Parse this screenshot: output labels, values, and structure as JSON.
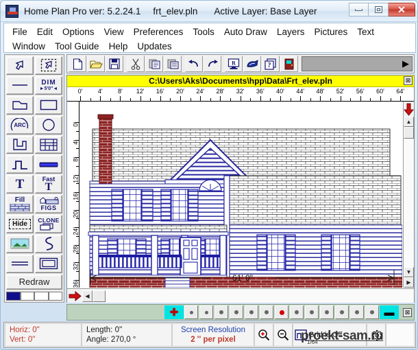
{
  "window": {
    "app_title": "Home Plan Pro ver: 5.2.24.1",
    "file_name": "frt_elev.pln",
    "active_layer": "Active Layer: Base Layer",
    "minimize_label": "Minimize",
    "maximize_label": "Maximize",
    "close_label": "✕",
    "app_icon": "home-plan-pro-icon"
  },
  "menu": {
    "row1": [
      "File",
      "Edit",
      "Options",
      "View",
      "Preferences",
      "Tools",
      "Auto Draw",
      "Layers",
      "Pictures",
      "Text"
    ],
    "row2": [
      "Window",
      "Tool Guide",
      "Help",
      "Updates"
    ]
  },
  "toolbar": {
    "buttons": [
      {
        "name": "new-file-icon",
        "label": "New"
      },
      {
        "name": "open-file-icon",
        "label": "Open"
      },
      {
        "name": "save-file-icon",
        "label": "Save"
      },
      {
        "name": "cut-icon",
        "label": "Cut"
      },
      {
        "name": "copy-icon",
        "label": "Copy"
      },
      {
        "name": "paste-icon",
        "label": "Paste"
      },
      {
        "name": "undo-icon",
        "label": "Undo"
      },
      {
        "name": "redo-icon",
        "label": "Redo"
      },
      {
        "name": "redraw-screen-icon",
        "label": "R"
      },
      {
        "name": "print-icon",
        "label": "Print"
      },
      {
        "name": "help-icon",
        "label": "Help"
      },
      {
        "name": "door-icon",
        "label": "Door"
      }
    ],
    "combo_value": "",
    "combo_arrow": "▶"
  },
  "tool_palette": {
    "rows": [
      [
        {
          "name": "select-arrow-tool",
          "label": ""
        },
        {
          "name": "marquee-select-tool",
          "label": ""
        }
      ],
      [
        {
          "name": "line-tool",
          "label": ""
        },
        {
          "name": "dimension-tool",
          "label": "DIM"
        }
      ],
      [
        {
          "name": "polygon-tool",
          "label": ""
        },
        {
          "name": "rectangle-tool",
          "label": ""
        }
      ],
      [
        {
          "name": "arc-tool",
          "label": "ARC"
        },
        {
          "name": "circle-tool",
          "label": ""
        }
      ],
      [
        {
          "name": "wall-tool",
          "label": ""
        },
        {
          "name": "window-tool",
          "label": ""
        }
      ],
      [
        {
          "name": "stairs-tool",
          "label": ""
        },
        {
          "name": "beam-tool",
          "label": ""
        }
      ],
      [
        {
          "name": "text-tool",
          "label": "T"
        },
        {
          "name": "fast-text-tool",
          "label": "Fast T"
        }
      ],
      [
        {
          "name": "fill-tool",
          "label": "Fill"
        },
        {
          "name": "figures-tool",
          "label": "FIGS"
        }
      ],
      [
        {
          "name": "hide-tool",
          "label": "Hide"
        },
        {
          "name": "clone-tool",
          "label": "CLONE"
        }
      ],
      [
        {
          "name": "picture-tool",
          "label": ""
        },
        {
          "name": "curve-tool",
          "label": ""
        }
      ],
      [
        {
          "name": "double-line-tool",
          "label": ""
        },
        {
          "name": "frame-tool",
          "label": ""
        }
      ]
    ],
    "redraw_label": "Redraw",
    "color_swatches": [
      "#10108c",
      "#ffffff",
      "#ffffff",
      "#ffffff"
    ]
  },
  "canvas": {
    "file_path": "C:\\Users\\Aks\\Documents\\hpp\\Data\\Frt_elev.pln",
    "close_label": "⊠",
    "h_ruler_labels": [
      "0'",
      "4'",
      "8'",
      "12'",
      "16'",
      "20'",
      "24'",
      "28'",
      "32'",
      "36'",
      "40'",
      "44'",
      "48'",
      "52'",
      "56'",
      "60'",
      "64'"
    ],
    "v_ruler_labels": [
      "0'",
      "4'",
      "8'",
      "12'",
      "16'",
      "20'",
      "24'",
      "28'",
      "32'",
      "36'"
    ],
    "dimension_label": "61' 0\"",
    "drawing_name": "front-elevation-house-drawing",
    "scroll_up": "▲",
    "scroll_down": "▼",
    "scroll_left": "◀",
    "scroll_right": "▶"
  },
  "line_weight_bar": {
    "increase_label": "✚",
    "decrease_label": "▬",
    "dot_sizes": [
      5,
      5,
      6,
      6,
      6,
      6,
      7,
      6,
      6,
      6,
      6,
      6,
      6
    ],
    "selected_index": 6,
    "close_label": "⊠"
  },
  "status": {
    "horiz_label": "Horiz:",
    "horiz_value": "0\"",
    "vert_label": "Vert:",
    "vert_value": "0\"",
    "length_label": "Length:",
    "length_value": "0''",
    "angle_label": "Angle:",
    "angle_value": "270,0 °",
    "resolution_title": "Screen Resolution",
    "resolution_value": "2 '' per pixel",
    "zoom_in": "zoom-in-icon",
    "zoom_out": "zoom-out-icon",
    "grid_icon": "grid-snap-icon",
    "grid_fraction": "1/64",
    "grid_text": "Grid is Off",
    "settings_icon": "gear-icon"
  },
  "watermark": "proekt-sam.ru",
  "colors": {
    "title_bg": "#e2edf8",
    "path_bar": "#ffff00",
    "accent_red": "#c0392b",
    "accent_blue": "#1a3fa8",
    "cyan": "#00e4e4",
    "brick": "#8b2020",
    "roof": "#ffffff",
    "wall_blue": "#1a1a8c"
  }
}
